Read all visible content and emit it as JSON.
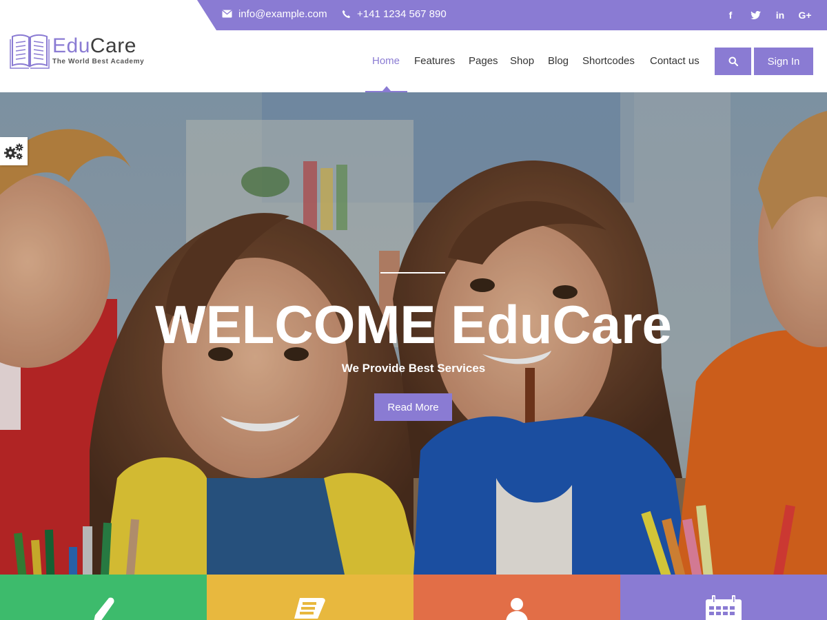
{
  "topbar": {
    "email": "info@example.com",
    "phone": "+141 1234 567 890",
    "social": [
      {
        "name": "facebook-icon",
        "glyph": "f"
      },
      {
        "name": "twitter-icon",
        "glyph": "t"
      },
      {
        "name": "linkedin-icon",
        "glyph": "in"
      },
      {
        "name": "googleplus-icon",
        "glyph": "G+"
      }
    ]
  },
  "brand": {
    "name_part1": "Edu",
    "name_part2": "Care",
    "tagline": "The World Best Academy",
    "accent_color": "#8a7bd3"
  },
  "nav": {
    "items": [
      {
        "label": "Home",
        "active": true
      },
      {
        "label": "Features",
        "active": false
      },
      {
        "label": "Pages",
        "active": false
      },
      {
        "label": "Shop",
        "active": false
      },
      {
        "label": "Blog",
        "active": false
      },
      {
        "label": "Shortcodes",
        "active": false
      },
      {
        "label": "Contact us",
        "active": false
      }
    ],
    "search_icon": "search-icon",
    "signin_label": "Sign In"
  },
  "hero": {
    "title": "WELCOME EduCare",
    "subtitle": "We Provide Best Services",
    "button_label": "Read More"
  },
  "features": [
    {
      "icon": "pencil-icon",
      "color": "#3dbb6c"
    },
    {
      "icon": "books-icon",
      "color": "#e8b83e"
    },
    {
      "icon": "user-icon",
      "color": "#e26e47"
    },
    {
      "icon": "calendar-icon",
      "color": "#8a7bd3"
    }
  ]
}
